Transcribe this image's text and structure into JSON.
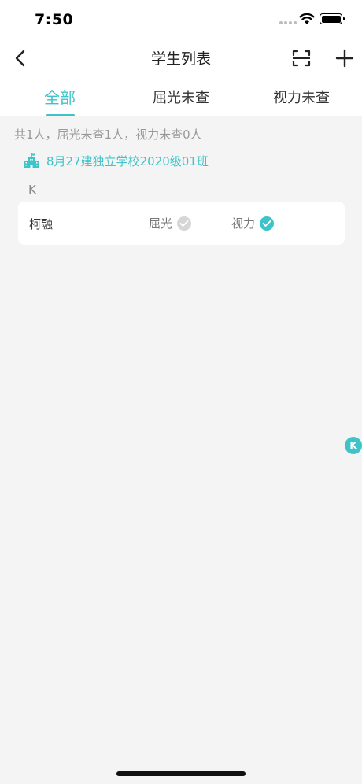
{
  "status_bar": {
    "time": "7:50"
  },
  "nav": {
    "title": "学生列表",
    "back_icon": "chevron-left-icon",
    "scan_icon": "scan-icon",
    "add_icon": "plus-icon"
  },
  "tabs": [
    {
      "label": "全部",
      "active": true
    },
    {
      "label": "屈光未查",
      "active": false
    },
    {
      "label": "视力未查",
      "active": false
    }
  ],
  "summary": "共1人，屈光未查1人，视力未查0人",
  "school": {
    "name": "8月27建独立学校2020级01班",
    "icon": "school-building-icon"
  },
  "groups": [
    {
      "letter": "K",
      "students": [
        {
          "name": "柯融",
          "refraction": {
            "label": "屈光",
            "checked": false
          },
          "vision": {
            "label": "视力",
            "checked": true
          }
        }
      ]
    }
  ],
  "index_bar": {
    "current": "K"
  },
  "colors": {
    "accent": "#3ec3c8",
    "background": "#f4f4f4",
    "inactive_check": "#d6d6d6"
  }
}
